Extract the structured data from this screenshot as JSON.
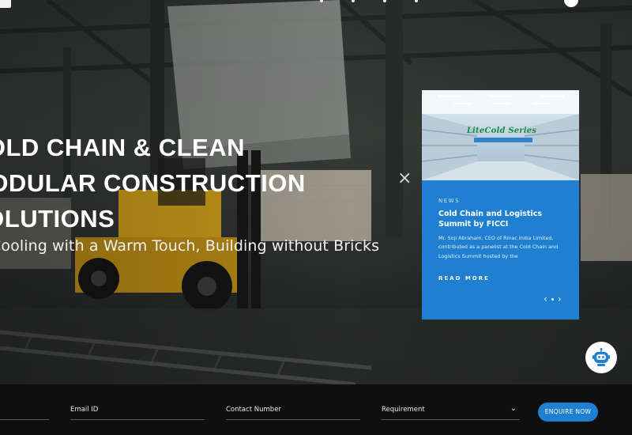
{
  "hero": {
    "headline_lines": [
      "COLD CHAIN & CLEAN",
      "MODULAR CONSTRUCTION",
      "SOLUTIONS"
    ],
    "tagline": "Cooling with a Warm Touch, Building without Bricks"
  },
  "news_popup": {
    "image_title": "LiteCold Series",
    "image_subtitle": "",
    "label": "NEWS",
    "title": "Cold Chain and Logistics Summit by FICCI",
    "body": "Mr. Soji Abraham, CEO of Rinac India Limited, contributed as a panelist at the Cold Chain and Logistics Summit hosted by the",
    "read_more": "READ MORE",
    "prev": "‹",
    "next": "›",
    "close": "×"
  },
  "enquiry": {
    "email_placeholder": "Email ID",
    "phone_placeholder": "Contact Number",
    "requirement_placeholder": "Requirement",
    "submit_label": "ENQUIRE NOW"
  },
  "colors": {
    "accent": "#1f7fd0",
    "footer_bg": "#0f0f0f"
  },
  "icons": {
    "chatbot": "robot-icon",
    "close": "close-icon",
    "requirement_dropdown": "chevron-down-icon"
  }
}
